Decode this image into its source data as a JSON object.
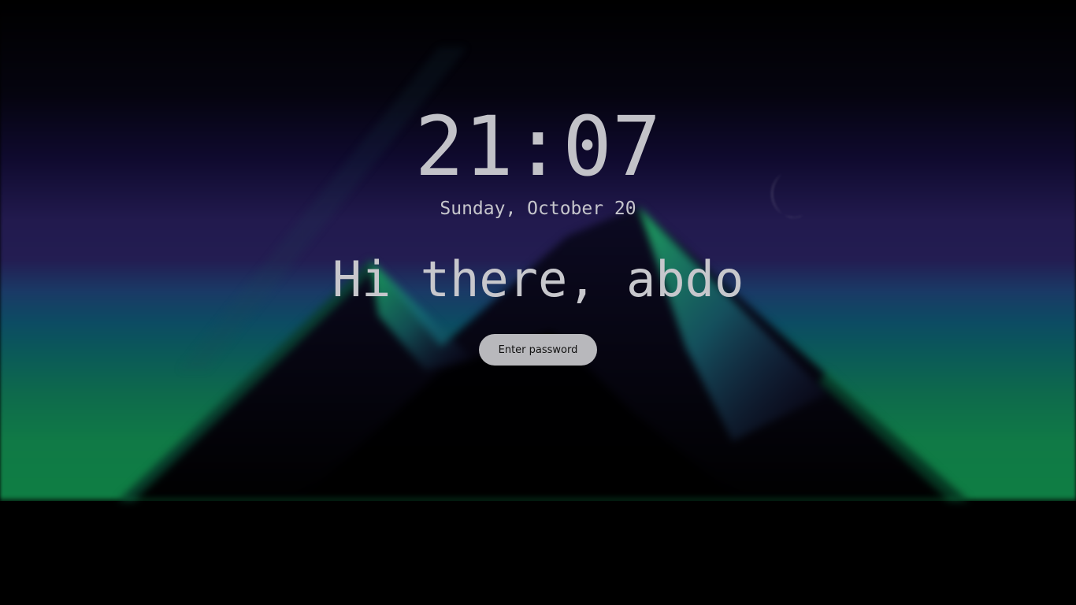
{
  "lockscreen": {
    "time": "21:07",
    "date": "Sunday, October 20",
    "greeting": "Hi there, abdo",
    "password": {
      "value": "",
      "placeholder": "Enter password"
    }
  },
  "wallpaper": {
    "icons": [
      "moon-icon"
    ],
    "colors": {
      "sky_top": "#000000",
      "sky_purple": "#231d52",
      "sky_teal": "#0c4c63",
      "horizon_green": "#0f7e44",
      "mountain_dark": "#080617",
      "ridge_green": "#1aa65a"
    }
  }
}
